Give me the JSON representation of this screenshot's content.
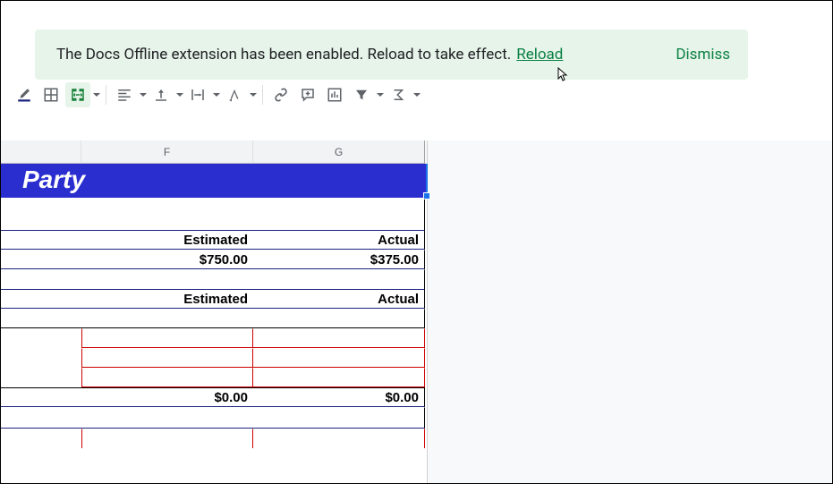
{
  "banner": {
    "message": "The Docs Offline extension has been enabled. Reload to take effect.",
    "reload": "Reload",
    "dismiss": "Dismiss"
  },
  "columns": {
    "f": "F",
    "g": "G"
  },
  "sheet": {
    "title": "Party",
    "headers1": {
      "estimated": "Estimated",
      "actual": "Actual"
    },
    "values1": {
      "estimated": "$750.00",
      "actual": "$375.00"
    },
    "headers2": {
      "estimated": "Estimated",
      "actual": "Actual"
    },
    "totals2": {
      "estimated": "$0.00",
      "actual": "$0.00"
    }
  }
}
